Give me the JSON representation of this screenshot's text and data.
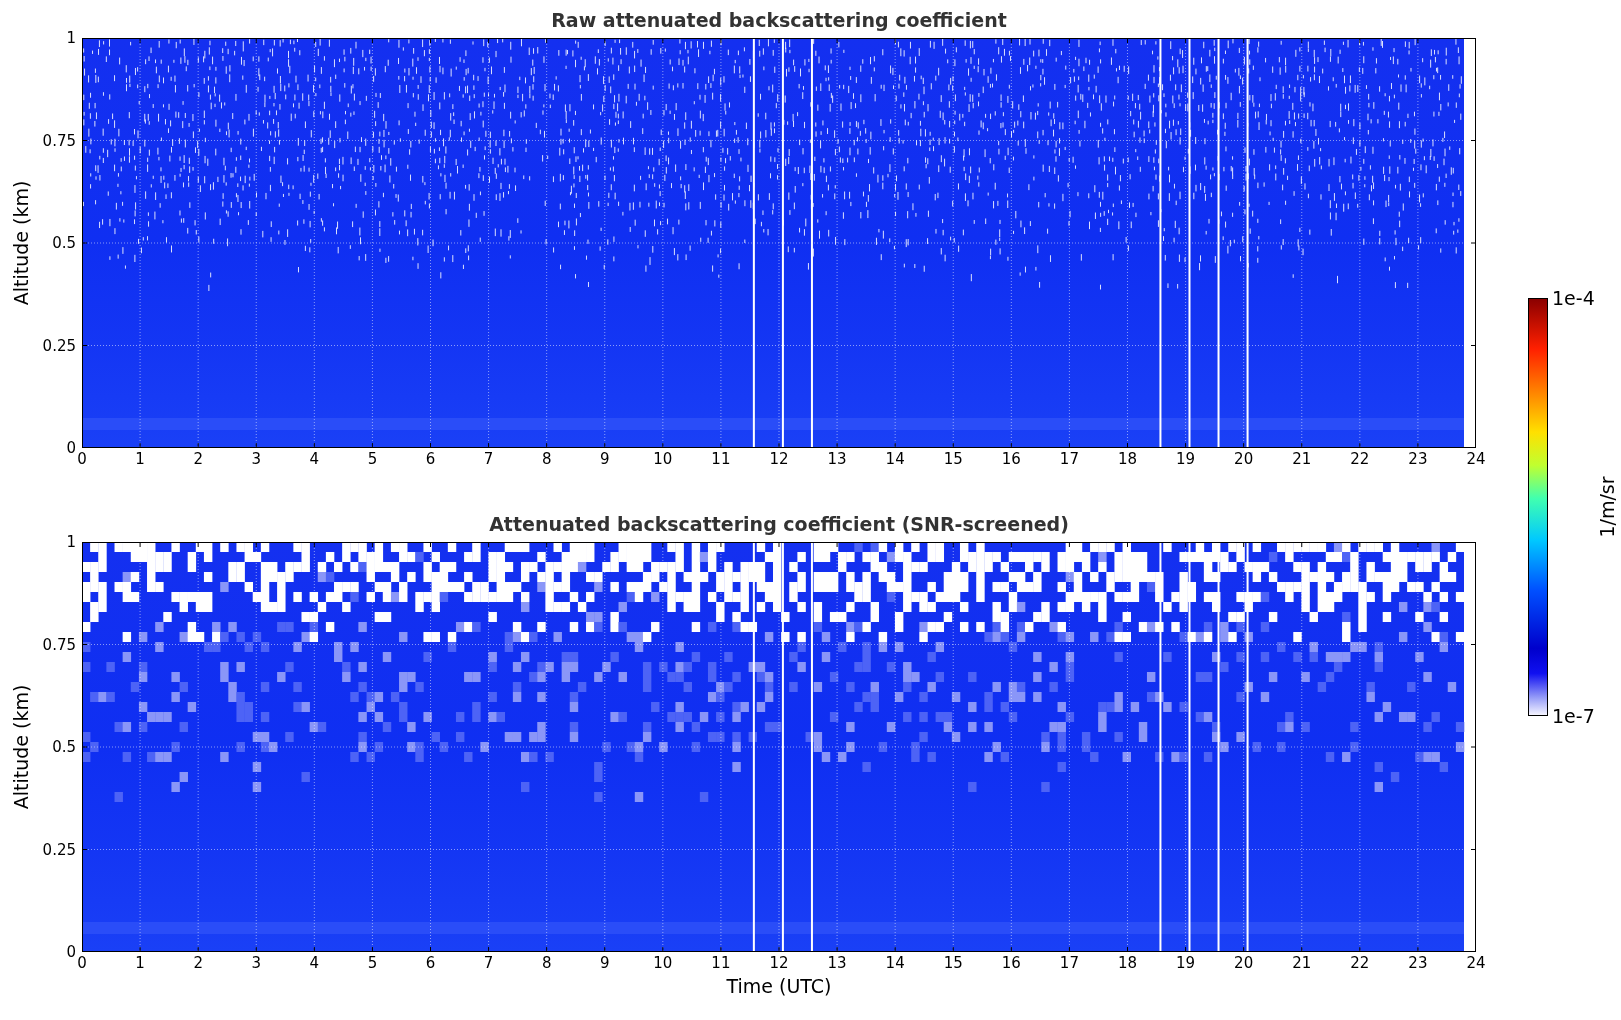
{
  "panels": [
    {
      "kind": "raw",
      "title": "Raw attenuated backscattering coefficient",
      "ylabel": "Altitude (km)",
      "yticks": [
        "1",
        "0.75",
        "0.5",
        "0.25",
        "0"
      ],
      "xticks": [
        "0",
        "1",
        "2",
        "3",
        "4",
        "5",
        "6",
        "7",
        "8",
        "9",
        "10",
        "11",
        "12",
        "13",
        "14",
        "15",
        "16",
        "17",
        "18",
        "19",
        "20",
        "21",
        "22",
        "23",
        "24"
      ]
    },
    {
      "kind": "screened",
      "title": "Attenuated backscattering coefficient (SNR-screened)",
      "ylabel": "Altitude (km)",
      "yticks": [
        "1",
        "0.75",
        "0.5",
        "0.25",
        "0"
      ],
      "xticks": [
        "0",
        "1",
        "2",
        "3",
        "4",
        "5",
        "6",
        "7",
        "8",
        "9",
        "10",
        "11",
        "12",
        "13",
        "14",
        "15",
        "16",
        "17",
        "18",
        "19",
        "20",
        "21",
        "22",
        "23",
        "24"
      ],
      "xlabel": "Time (UTC)"
    }
  ],
  "colorbar": {
    "max_label": "1e-4",
    "min_label": "1e-7",
    "label": "1/m/sr"
  }
}
